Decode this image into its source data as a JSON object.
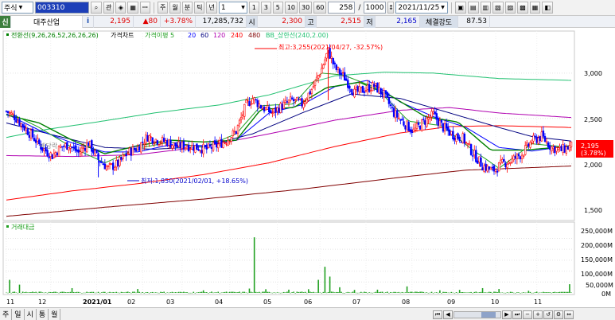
{
  "toolbar": {
    "asset_type": "주식",
    "stock_code": "003310",
    "search_btn": "⌕",
    "tools": [
      "관",
      "◈",
      "▦",
      "ꟷ"
    ],
    "period_buttons": [
      "주",
      "월",
      "분",
      "틱",
      "년"
    ],
    "minute_select": "1",
    "interval_buttons": [
      "1",
      "3",
      "5",
      "10",
      "30",
      "60"
    ],
    "count_value": "258",
    "total_value": "1000",
    "date": "2021/11/25",
    "right_tools": [
      "▣",
      "▤",
      "▥",
      "▧",
      "▨",
      "▩",
      "▦",
      "◧"
    ]
  },
  "quote_bar": {
    "market_flag": "신",
    "stock_name": "대주산업",
    "info": "i",
    "price": "2,195",
    "change": "▲80",
    "change_pct": "+3.78%",
    "volume": "17,285,732",
    "open_label": "시",
    "open": "2,300",
    "high_label": "고",
    "high": "2,515",
    "low_label": "저",
    "low": "2,165",
    "strength_label": "체결강도",
    "strength": "87.53"
  },
  "legend": {
    "items": [
      {
        "text": "전환선(9,26,26,52,26,26,26)",
        "color": "#008000"
      },
      {
        "text": "가격차트",
        "color": "#000000"
      },
      {
        "text": "가격이평 5",
        "color": "#21a021"
      },
      {
        "text": "20",
        "color": "#0000ff"
      },
      {
        "text": "60",
        "color": "#000080"
      },
      {
        "text": "120",
        "color": "#b000b0"
      },
      {
        "text": "240",
        "color": "#ff0000"
      },
      {
        "text": "480",
        "color": "#800000"
      },
      {
        "text": "BB_상한선(240,2.00)",
        "color": "#20c070"
      }
    ]
  },
  "volume_legend": "거래대금",
  "annotations": {
    "max_label": "최고:3,255(2021/04/27, -32.57%)",
    "min_label": "최저:1,850(2021/02/01, +18.65%)",
    "bg_text": "배당락"
  },
  "price_axis": {
    "ticks": [
      "3,000",
      "2,500",
      "2,000",
      "1,500"
    ],
    "current_price": "2,195",
    "current_pct": "(3.78%)"
  },
  "volume_axis": {
    "ticks": [
      "250,000M",
      "200,000M",
      "150,000M",
      "100,000M",
      "50,000M",
      "0M"
    ]
  },
  "x_axis": {
    "labels": [
      "11",
      "12",
      "2021/01",
      "02",
      "03",
      "04",
      "05",
      "06",
      "07",
      "08",
      "09",
      "10",
      "11"
    ]
  },
  "footer": {
    "tabs": [
      "주",
      "일",
      "시",
      "통",
      "월"
    ]
  },
  "chart_data": {
    "type": "candlestick",
    "price_range": [
      1400,
      3350
    ],
    "volume_range": [
      0,
      270000
    ],
    "months": [
      "11",
      "12",
      "2021/01",
      "02",
      "03",
      "04",
      "05",
      "06",
      "07",
      "08",
      "09",
      "10",
      "11"
    ],
    "close_path": [
      [
        0,
        2580
      ],
      [
        5,
        2520
      ],
      [
        10,
        2420
      ],
      [
        16,
        2300
      ],
      [
        22,
        2170
      ],
      [
        28,
        2090
      ],
      [
        33,
        2180
      ],
      [
        38,
        2210
      ],
      [
        44,
        2120
      ],
      [
        50,
        2230
      ],
      [
        56,
        2050
      ],
      [
        62,
        1950
      ],
      [
        68,
        2000
      ],
      [
        74,
        2120
      ],
      [
        80,
        2180
      ],
      [
        86,
        2300
      ],
      [
        92,
        2260
      ],
      [
        98,
        2240
      ],
      [
        104,
        2190
      ],
      [
        110,
        2200
      ],
      [
        116,
        2180
      ],
      [
        122,
        2160
      ],
      [
        128,
        2200
      ],
      [
        134,
        2260
      ],
      [
        140,
        2360
      ],
      [
        146,
        2650
      ],
      [
        150,
        2720
      ],
      [
        156,
        2620
      ],
      [
        162,
        2560
      ],
      [
        168,
        2640
      ],
      [
        174,
        2700
      ],
      [
        180,
        2660
      ],
      [
        186,
        2820
      ],
      [
        192,
        3050
      ],
      [
        196,
        3250
      ],
      [
        200,
        3060
      ],
      [
        206,
        2950
      ],
      [
        212,
        2780
      ],
      [
        218,
        2820
      ],
      [
        224,
        2860
      ],
      [
        230,
        2760
      ],
      [
        236,
        2560
      ],
      [
        242,
        2450
      ],
      [
        248,
        2360
      ],
      [
        254,
        2460
      ],
      [
        260,
        2540
      ],
      [
        266,
        2400
      ],
      [
        272,
        2320
      ],
      [
        278,
        2280
      ],
      [
        284,
        2120
      ],
      [
        290,
        1980
      ],
      [
        296,
        1920
      ],
      [
        302,
        2000
      ],
      [
        308,
        2040
      ],
      [
        314,
        2110
      ],
      [
        320,
        2250
      ],
      [
        326,
        2300
      ],
      [
        332,
        2180
      ],
      [
        338,
        2150
      ],
      [
        344,
        2195
      ]
    ],
    "volume_spikes": [
      {
        "i": 2,
        "v": 60000
      },
      {
        "i": 8,
        "v": 38000
      },
      {
        "i": 40,
        "v": 22000
      },
      {
        "i": 80,
        "v": 18000
      },
      {
        "i": 120,
        "v": 12000
      },
      {
        "i": 148,
        "v": 20000
      },
      {
        "i": 151,
        "v": 255000
      },
      {
        "i": 158,
        "v": 17000
      },
      {
        "i": 172,
        "v": 15000
      },
      {
        "i": 184,
        "v": 17000
      },
      {
        "i": 190,
        "v": 60000
      },
      {
        "i": 194,
        "v": 120000
      },
      {
        "i": 197,
        "v": 75000
      },
      {
        "i": 203,
        "v": 26000
      },
      {
        "i": 212,
        "v": 14000
      },
      {
        "i": 226,
        "v": 15000
      },
      {
        "i": 244,
        "v": 30000
      },
      {
        "i": 264,
        "v": 12000
      },
      {
        "i": 276,
        "v": 14000
      },
      {
        "i": 290,
        "v": 22000
      },
      {
        "i": 300,
        "v": 18000
      },
      {
        "i": 318,
        "v": 10000
      },
      {
        "i": 343,
        "v": 40000
      }
    ],
    "ma_lines": [
      {
        "name": "BB_상한선",
        "color": "#20c070",
        "points": [
          [
            0,
            2290
          ],
          [
            25,
            2380
          ],
          [
            55,
            2460
          ],
          [
            90,
            2560
          ],
          [
            130,
            2650
          ],
          [
            160,
            2760
          ],
          [
            200,
            2970
          ],
          [
            230,
            3010
          ],
          [
            260,
            3000
          ],
          [
            300,
            2940
          ],
          [
            344,
            2920
          ]
        ]
      },
      {
        "name": "240",
        "color": "#ff0000",
        "points": [
          [
            0,
            1600
          ],
          [
            40,
            1700
          ],
          [
            80,
            1780
          ],
          [
            120,
            1880
          ],
          [
            160,
            2010
          ],
          [
            200,
            2190
          ],
          [
            240,
            2340
          ],
          [
            270,
            2410
          ],
          [
            300,
            2420
          ],
          [
            344,
            2400
          ]
        ]
      },
      {
        "name": "480",
        "color": "#800000",
        "points": [
          [
            0,
            1420
          ],
          [
            60,
            1520
          ],
          [
            120,
            1610
          ],
          [
            180,
            1720
          ],
          [
            240,
            1850
          ],
          [
            280,
            1930
          ],
          [
            310,
            1950
          ],
          [
            344,
            1975
          ]
        ]
      },
      {
        "name": "120",
        "color": "#b000b0",
        "points": [
          [
            0,
            2090
          ],
          [
            40,
            2080
          ],
          [
            80,
            2100
          ],
          [
            120,
            2190
          ],
          [
            160,
            2330
          ],
          [
            200,
            2480
          ],
          [
            240,
            2590
          ],
          [
            270,
            2620
          ],
          [
            300,
            2560
          ],
          [
            344,
            2510
          ]
        ]
      },
      {
        "name": "60",
        "color": "#000080",
        "points": [
          [
            0,
            2450
          ],
          [
            30,
            2310
          ],
          [
            60,
            2180
          ],
          [
            90,
            2160
          ],
          [
            120,
            2190
          ],
          [
            150,
            2330
          ],
          [
            180,
            2560
          ],
          [
            210,
            2770
          ],
          [
            240,
            2720
          ],
          [
            270,
            2560
          ],
          [
            300,
            2400
          ],
          [
            320,
            2300
          ],
          [
            344,
            2250
          ]
        ]
      },
      {
        "name": "20",
        "color": "#0000ff",
        "points": [
          [
            0,
            2550
          ],
          [
            20,
            2370
          ],
          [
            40,
            2230
          ],
          [
            60,
            2130
          ],
          [
            80,
            2130
          ],
          [
            100,
            2210
          ],
          [
            120,
            2200
          ],
          [
            140,
            2260
          ],
          [
            160,
            2560
          ],
          [
            180,
            2650
          ],
          [
            200,
            2850
          ],
          [
            220,
            2920
          ],
          [
            240,
            2680
          ],
          [
            260,
            2520
          ],
          [
            280,
            2400
          ],
          [
            300,
            2180
          ],
          [
            320,
            2140
          ],
          [
            344,
            2200
          ]
        ]
      },
      {
        "name": "전환선",
        "color": "#008000",
        "points": [
          [
            0,
            2540
          ],
          [
            20,
            2450
          ],
          [
            40,
            2260
          ],
          [
            60,
            2110
          ],
          [
            80,
            2200
          ],
          [
            100,
            2260
          ],
          [
            120,
            2240
          ],
          [
            140,
            2260
          ],
          [
            155,
            2600
          ],
          [
            175,
            2620
          ],
          [
            195,
            2840
          ],
          [
            215,
            2900
          ],
          [
            235,
            2740
          ],
          [
            255,
            2520
          ],
          [
            275,
            2460
          ],
          [
            295,
            2150
          ],
          [
            315,
            2150
          ],
          [
            335,
            2180
          ],
          [
            344,
            2200
          ]
        ]
      },
      {
        "name": "5",
        "color": "#21a021",
        "points": [
          [
            0,
            2580
          ],
          [
            20,
            2400
          ],
          [
            40,
            2180
          ],
          [
            60,
            2010
          ],
          [
            80,
            2170
          ],
          [
            100,
            2240
          ],
          [
            120,
            2180
          ],
          [
            140,
            2330
          ],
          [
            155,
            2640
          ],
          [
            175,
            2660
          ],
          [
            192,
            3000
          ],
          [
            205,
            2980
          ],
          [
            225,
            2840
          ],
          [
            245,
            2470
          ],
          [
            265,
            2420
          ],
          [
            285,
            2140
          ],
          [
            300,
            1950
          ],
          [
            320,
            2220
          ],
          [
            344,
            2180
          ]
        ]
      }
    ]
  }
}
